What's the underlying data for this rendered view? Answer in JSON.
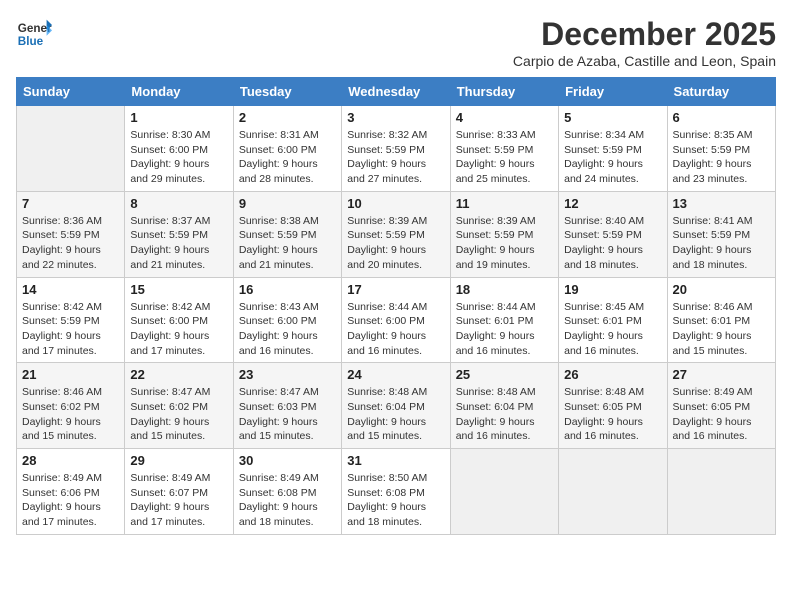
{
  "header": {
    "logo_general": "General",
    "logo_blue": "Blue",
    "month_title": "December 2025",
    "subtitle": "Carpio de Azaba, Castille and Leon, Spain"
  },
  "weekdays": [
    "Sunday",
    "Monday",
    "Tuesday",
    "Wednesday",
    "Thursday",
    "Friday",
    "Saturday"
  ],
  "weeks": [
    [
      {
        "day": "",
        "info": ""
      },
      {
        "day": "1",
        "info": "Sunrise: 8:30 AM\nSunset: 6:00 PM\nDaylight: 9 hours\nand 29 minutes."
      },
      {
        "day": "2",
        "info": "Sunrise: 8:31 AM\nSunset: 6:00 PM\nDaylight: 9 hours\nand 28 minutes."
      },
      {
        "day": "3",
        "info": "Sunrise: 8:32 AM\nSunset: 5:59 PM\nDaylight: 9 hours\nand 27 minutes."
      },
      {
        "day": "4",
        "info": "Sunrise: 8:33 AM\nSunset: 5:59 PM\nDaylight: 9 hours\nand 25 minutes."
      },
      {
        "day": "5",
        "info": "Sunrise: 8:34 AM\nSunset: 5:59 PM\nDaylight: 9 hours\nand 24 minutes."
      },
      {
        "day": "6",
        "info": "Sunrise: 8:35 AM\nSunset: 5:59 PM\nDaylight: 9 hours\nand 23 minutes."
      }
    ],
    [
      {
        "day": "7",
        "info": "Sunrise: 8:36 AM\nSunset: 5:59 PM\nDaylight: 9 hours\nand 22 minutes."
      },
      {
        "day": "8",
        "info": "Sunrise: 8:37 AM\nSunset: 5:59 PM\nDaylight: 9 hours\nand 21 minutes."
      },
      {
        "day": "9",
        "info": "Sunrise: 8:38 AM\nSunset: 5:59 PM\nDaylight: 9 hours\nand 21 minutes."
      },
      {
        "day": "10",
        "info": "Sunrise: 8:39 AM\nSunset: 5:59 PM\nDaylight: 9 hours\nand 20 minutes."
      },
      {
        "day": "11",
        "info": "Sunrise: 8:39 AM\nSunset: 5:59 PM\nDaylight: 9 hours\nand 19 minutes."
      },
      {
        "day": "12",
        "info": "Sunrise: 8:40 AM\nSunset: 5:59 PM\nDaylight: 9 hours\nand 18 minutes."
      },
      {
        "day": "13",
        "info": "Sunrise: 8:41 AM\nSunset: 5:59 PM\nDaylight: 9 hours\nand 18 minutes."
      }
    ],
    [
      {
        "day": "14",
        "info": "Sunrise: 8:42 AM\nSunset: 5:59 PM\nDaylight: 9 hours\nand 17 minutes."
      },
      {
        "day": "15",
        "info": "Sunrise: 8:42 AM\nSunset: 6:00 PM\nDaylight: 9 hours\nand 17 minutes."
      },
      {
        "day": "16",
        "info": "Sunrise: 8:43 AM\nSunset: 6:00 PM\nDaylight: 9 hours\nand 16 minutes."
      },
      {
        "day": "17",
        "info": "Sunrise: 8:44 AM\nSunset: 6:00 PM\nDaylight: 9 hours\nand 16 minutes."
      },
      {
        "day": "18",
        "info": "Sunrise: 8:44 AM\nSunset: 6:01 PM\nDaylight: 9 hours\nand 16 minutes."
      },
      {
        "day": "19",
        "info": "Sunrise: 8:45 AM\nSunset: 6:01 PM\nDaylight: 9 hours\nand 16 minutes."
      },
      {
        "day": "20",
        "info": "Sunrise: 8:46 AM\nSunset: 6:01 PM\nDaylight: 9 hours\nand 15 minutes."
      }
    ],
    [
      {
        "day": "21",
        "info": "Sunrise: 8:46 AM\nSunset: 6:02 PM\nDaylight: 9 hours\nand 15 minutes."
      },
      {
        "day": "22",
        "info": "Sunrise: 8:47 AM\nSunset: 6:02 PM\nDaylight: 9 hours\nand 15 minutes."
      },
      {
        "day": "23",
        "info": "Sunrise: 8:47 AM\nSunset: 6:03 PM\nDaylight: 9 hours\nand 15 minutes."
      },
      {
        "day": "24",
        "info": "Sunrise: 8:48 AM\nSunset: 6:04 PM\nDaylight: 9 hours\nand 15 minutes."
      },
      {
        "day": "25",
        "info": "Sunrise: 8:48 AM\nSunset: 6:04 PM\nDaylight: 9 hours\nand 16 minutes."
      },
      {
        "day": "26",
        "info": "Sunrise: 8:48 AM\nSunset: 6:05 PM\nDaylight: 9 hours\nand 16 minutes."
      },
      {
        "day": "27",
        "info": "Sunrise: 8:49 AM\nSunset: 6:05 PM\nDaylight: 9 hours\nand 16 minutes."
      }
    ],
    [
      {
        "day": "28",
        "info": "Sunrise: 8:49 AM\nSunset: 6:06 PM\nDaylight: 9 hours\nand 17 minutes."
      },
      {
        "day": "29",
        "info": "Sunrise: 8:49 AM\nSunset: 6:07 PM\nDaylight: 9 hours\nand 17 minutes."
      },
      {
        "day": "30",
        "info": "Sunrise: 8:49 AM\nSunset: 6:08 PM\nDaylight: 9 hours\nand 18 minutes."
      },
      {
        "day": "31",
        "info": "Sunrise: 8:50 AM\nSunset: 6:08 PM\nDaylight: 9 hours\nand 18 minutes."
      },
      {
        "day": "",
        "info": ""
      },
      {
        "day": "",
        "info": ""
      },
      {
        "day": "",
        "info": ""
      }
    ]
  ]
}
